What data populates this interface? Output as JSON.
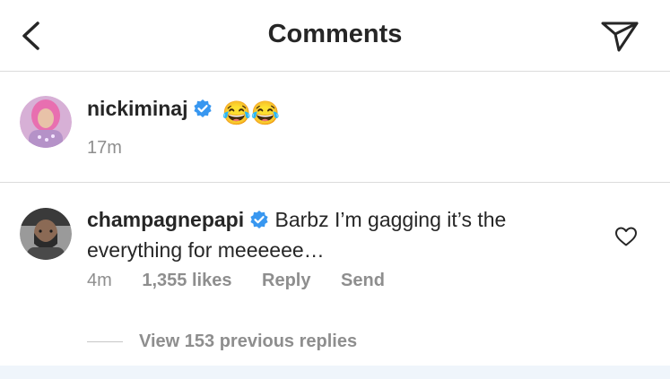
{
  "header": {
    "title": "Comments",
    "back_icon": "chevron-left-icon",
    "send_icon": "paper-plane-icon"
  },
  "caption": {
    "username": "nickiminaj",
    "verified": true,
    "text_emoji": "😂😂",
    "time": "17m"
  },
  "comment": {
    "username": "champagnepapi",
    "verified": true,
    "text": "Barbz I’m gagging it’s the everything for meeeeee…",
    "time": "4m",
    "likes": "1,355 likes",
    "reply_label": "Reply",
    "send_label": "Send",
    "like_icon": "heart-outline-icon"
  },
  "replies": {
    "view_label": "View 153 previous replies"
  },
  "colors": {
    "primary_text": "#262626",
    "secondary_text": "#8e8e8e",
    "verified_blue": "#3897f0",
    "divider": "#dbdbdb"
  }
}
